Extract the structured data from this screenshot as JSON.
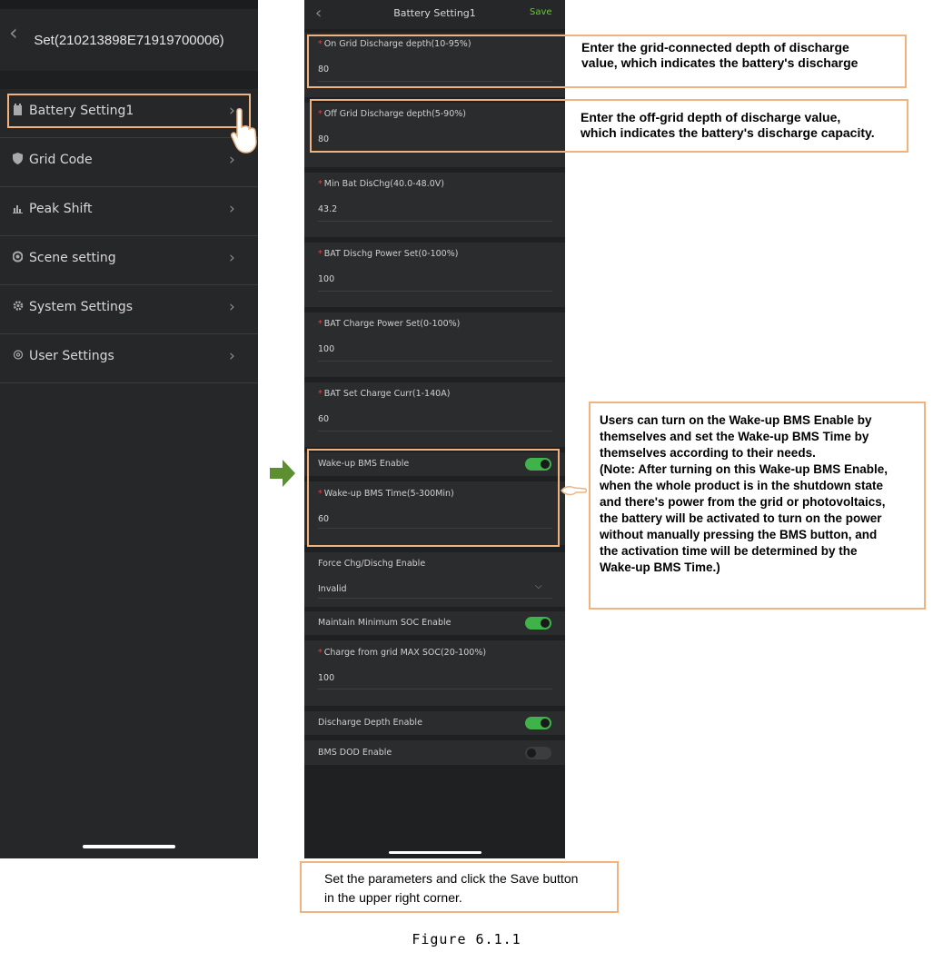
{
  "left_screen": {
    "title": "Set(210213898E71919700006)",
    "menu": [
      {
        "label": "Battery Setting1",
        "icon": "battery-icon"
      },
      {
        "label": "Grid Code",
        "icon": "shield-icon"
      },
      {
        "label": "Peak Shift",
        "icon": "chart-icon"
      },
      {
        "label": "Scene setting",
        "icon": "scene-icon"
      },
      {
        "label": "System Settings",
        "icon": "gear-icon"
      },
      {
        "label": "User Settings",
        "icon": "user-icon"
      }
    ]
  },
  "right_screen": {
    "title": "Battery Setting1",
    "save_label": "Save",
    "fields": [
      {
        "label": "On Grid Discharge depth(10-95%)",
        "value": "80"
      },
      {
        "label": "Off Grid Discharge depth(5-90%)",
        "value": "80"
      },
      {
        "label": "Min Bat DisChg(40.0-48.0V)",
        "value": "43.2"
      },
      {
        "label": "BAT Dischg Power Set(0-100%)",
        "value": "100"
      },
      {
        "label": "BAT Charge Power Set(0-100%)",
        "value": "100"
      },
      {
        "label": "BAT Set Charge Curr(1-140A)",
        "value": "60"
      }
    ],
    "wakeup_toggle_label": "Wake-up BMS Enable",
    "wakeup_time_label": "Wake-up BMS Time(5-300Min)",
    "wakeup_time_value": "60",
    "force_label": "Force Chg/Dischg Enable",
    "force_value": "Invalid",
    "maintain_soc_label": "Maintain Minimum SOC Enable",
    "grid_soc_label": "Charge from grid MAX SOC(20-100%)",
    "grid_soc_value": "100",
    "discharge_depth_label": "Discharge Depth Enable",
    "bms_dod_label": "BMS DOD Enable"
  },
  "annotations": {
    "on_grid": "Enter the grid-connected depth of discharge\nvalue, which indicates the battery's discharge",
    "off_grid": "Enter the off-grid depth of discharge value,\nwhich indicates the battery's discharge capacity.",
    "wakeup": "Users can turn on the Wake-up BMS Enable by\nthemselves and set the Wake-up BMS Time by\nthemselves according to their needs.\n (Note: After turning on this Wake-up BMS Enable,\nwhen the whole product is in the shutdown state\nand there's power from the grid or photovoltaics,\nthe battery will be activated to turn on the power\nwithout manually pressing the BMS button, and\nthe activation time will be determined by the\nWake-up BMS Time.)",
    "save": "Set the parameters and click the Save button\nin the upper right corner."
  },
  "figure_caption": "Figure 6.1.1",
  "colors": {
    "accent_green": "#3fb34a",
    "highlight": "#f0b27e",
    "arrow": "#5b8f2f"
  }
}
